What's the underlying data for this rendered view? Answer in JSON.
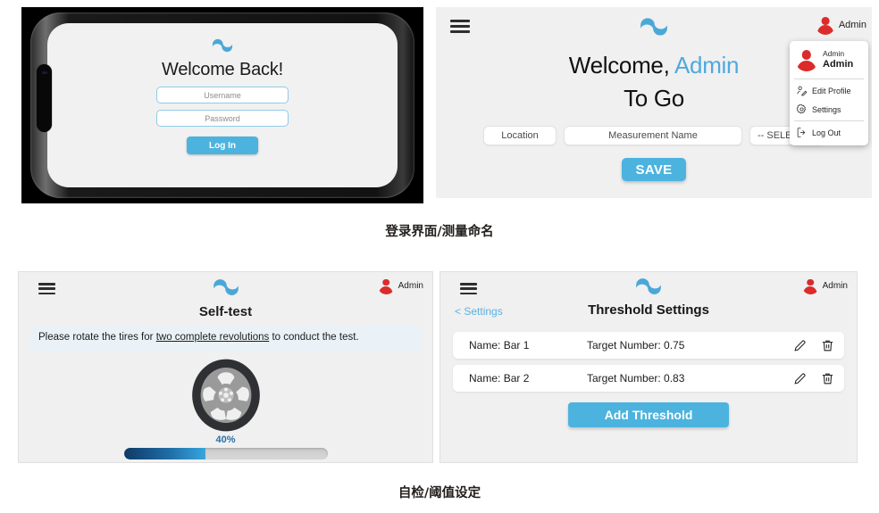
{
  "brand": {
    "logo_icon": "wave-logo-icon",
    "accent_color": "#4cb3de",
    "avatar_color": "#dc2b2b"
  },
  "login_panel": {
    "device": "phone-mockup",
    "title": "Welcome Back!",
    "username_placeholder": "Username",
    "password_placeholder": "Password",
    "login_button": "Log In"
  },
  "measure_panel": {
    "menu_icon": "hamburger-menu-icon",
    "user_label": "Admin",
    "welcome_prefix": "Welcome, ",
    "welcome_name": "Admin",
    "welcome_second_line": "To Go",
    "fields": {
      "location_placeholder": "Location",
      "measurement_name_placeholder": "Measurement Name",
      "select_value": "-- SELECT"
    },
    "save_button": "SAVE",
    "user_menu": {
      "name_top": "Admin",
      "name_bottom": "Admin",
      "items": [
        {
          "label": "Edit Profile",
          "icon": "edit-profile-icon"
        },
        {
          "label": "Settings",
          "icon": "gear-icon"
        },
        {
          "label": "Log Out",
          "icon": "logout-icon"
        }
      ]
    }
  },
  "selftest_panel": {
    "user_label": "Admin",
    "title": "Self-test",
    "note_before": "Please rotate the tires for ",
    "note_underlined": "two complete revolutions",
    "note_after": " to conduct the test.",
    "tire_icon": "tire-wheel-icon",
    "progress_label": "40%",
    "progress_value": 40
  },
  "threshold_panel": {
    "user_label": "Admin",
    "back_link": "< Settings",
    "title": "Threshold Settings",
    "rows": [
      {
        "name_label": "Name:",
        "name_value": "Bar 1",
        "target_label": "Target Number:",
        "target_value": "0.75",
        "edit_icon": "pencil-icon",
        "delete_icon": "trash-icon"
      },
      {
        "name_label": "Name:",
        "name_value": "Bar 2",
        "target_label": "Target Number:",
        "target_value": "0.83",
        "edit_icon": "pencil-icon",
        "delete_icon": "trash-icon"
      }
    ],
    "add_button": "Add Threshold"
  },
  "captions": {
    "top": "登录界面/测量命名",
    "bottom": "自检/阈值设定"
  }
}
